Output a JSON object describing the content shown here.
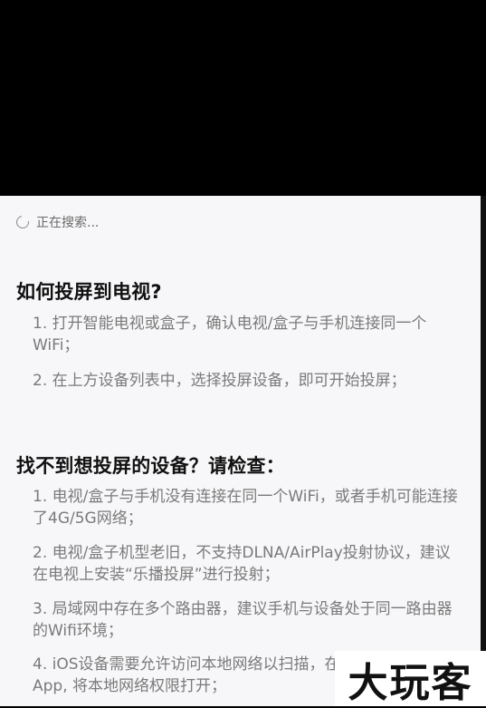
{
  "search_status": {
    "text": "正在搜索..."
  },
  "how_to": {
    "title": "如何投屏到电视?",
    "steps": [
      "1. 打开智能电视或盒子，确认电视/盒子与手机连接同一个WiFi；",
      "2. 在上方设备列表中，选择投屏设备，即可开始投屏；"
    ]
  },
  "troubleshoot": {
    "title": "找不到想投屏的设备？请检查：",
    "items": [
      "1. 电视/盒子与手机没有连接在同一个WiFi，或者手机可能连接了4G/5G网络；",
      "2. 电视/盒子机型老旧，不支持DLNA/AirPlay投射协议，建议在电视上安装“乐播投屏”进行投射；",
      "3. 局域网中存在多个路由器，建议手机与设备处于同一路由器的Wifi环境；",
      "4. iOS设备需要允许访问本地网络以扫描，在手机设置中找到本App, 将本地网络权限打开；"
    ]
  },
  "watermark": {
    "text": "大玩客"
  }
}
